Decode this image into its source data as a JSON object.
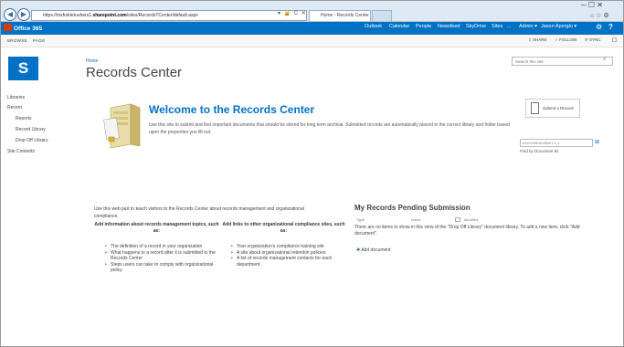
{
  "browser": {
    "url_prefix": "https://mshoklerushers1.",
    "url_domain": "sharepoint.com",
    "url_path": "/sites/RecordsTCenter/default.aspx",
    "tab_active": "Home - Records Center",
    "nav_back": "◀",
    "nav_forward": "▶",
    "addr_icons": "▾ 🔒 C ✕",
    "win_controls": "─ ☐ ✕",
    "toolbar_icons": "⌂ ☆ ⚙"
  },
  "suite_bar": {
    "brand": "Office 365",
    "links": [
      "Outlook",
      "Calendar",
      "People",
      "Newsfeed",
      "SkyDrive",
      "Sites",
      "...",
      "Admin ▾"
    ],
    "user": "Jason Aperglo ▾",
    "icons": [
      "gear-icon",
      "help-icon"
    ]
  },
  "ribbon": {
    "tabs": [
      "BROWSE",
      "PAGE"
    ],
    "actions": [
      "SHARE",
      "FOLLOW",
      "SYNC"
    ],
    "panel_icon": "☐"
  },
  "header": {
    "breadcrumb": "Home",
    "title": "Records Center",
    "search_placeholder": "Search this site"
  },
  "quick_launch": {
    "items": [
      "Libraries",
      "Recent",
      "Site Contents"
    ],
    "recent_children": [
      "Reports",
      "Record Library",
      "Drop Off Library"
    ]
  },
  "welcome": {
    "heading": "Welcome to the Records Center",
    "body": "Use this site to submit and find important documents that should be stored for long term archival. Submitted records are automatically placed in the correct library and folder based upon the properties you fill out."
  },
  "submit_record": {
    "label": "Submit a Record"
  },
  "doc_id": {
    "value": "42XXH5D3U96W7-1-1",
    "label": "Find by Document ID"
  },
  "intro": {
    "text": "Use this web part to teach visitors to the Records Center about records management and organizational compliance.",
    "columns": [
      {
        "heading": "Add information about records management topics, such as:",
        "items": [
          "The definition of a record in your organization",
          "What happens to a record after it is submitted to the Records Center",
          "Steps users can take to comply with organizational policy"
        ]
      },
      {
        "heading": "Add links to other organizational compliance sites, such as:",
        "items": [
          "Your organization's compliance training site",
          "A site about organizational retention policies",
          "A list of records management contacts for each department"
        ]
      }
    ]
  },
  "pending": {
    "title": "My Records Pending Submission",
    "columns": [
      "Type",
      "Name",
      "Modified"
    ],
    "message": "There are no items to show in this view of the \"Drop Off Library\" document library. To add a new item, click \"Add document\".",
    "add_label": "Add document"
  }
}
